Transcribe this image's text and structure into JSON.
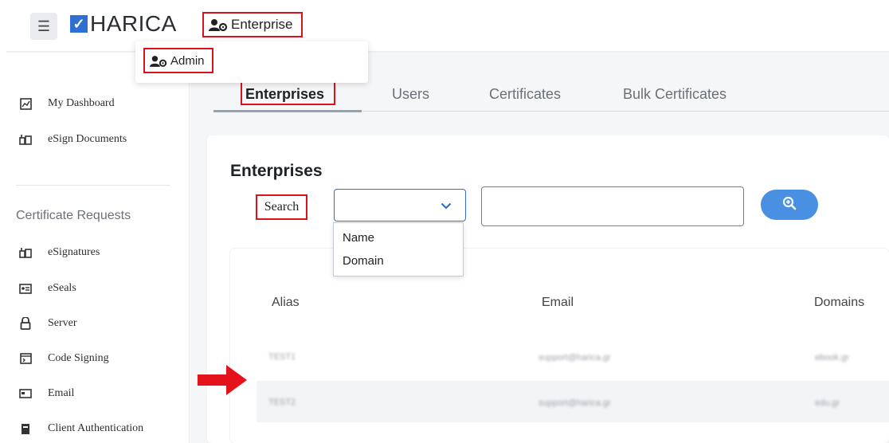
{
  "header": {
    "menu_icon": "hamburger-icon",
    "logo_text": "HARICA",
    "role_button_label": "Enterprise",
    "role_menu": {
      "item_label": "Admin"
    }
  },
  "sidebar": {
    "items_top": [
      {
        "label": "My Dashboard",
        "icon": "dashboard-icon"
      },
      {
        "label": "eSign Documents",
        "icon": "esign-documents-icon"
      }
    ],
    "section_heading": "Certificate Requests",
    "items": [
      {
        "label": "eSignatures",
        "icon": "esignature-icon"
      },
      {
        "label": "eSeals",
        "icon": "eseal-icon"
      },
      {
        "label": "Server",
        "icon": "lock-icon"
      },
      {
        "label": "Code Signing",
        "icon": "code-signing-icon"
      },
      {
        "label": "Email",
        "icon": "email-icon"
      },
      {
        "label": "Client Authentication",
        "icon": "client-auth-icon"
      }
    ]
  },
  "tabs": [
    "Enterprises",
    "Users",
    "Certificates",
    "Bulk Certificates"
  ],
  "active_tab": "Enterprises",
  "card": {
    "title": "Enterprises",
    "search_label": "Search",
    "select": {
      "selected_value": "",
      "options": [
        "Name",
        "Domain"
      ]
    },
    "search_input_value": "",
    "search_button_icon": "zoom-in-icon"
  },
  "table": {
    "columns": [
      "Alias",
      "Email",
      "Domains"
    ],
    "rows": [
      {
        "alias": "TEST1",
        "email": "support@harica.gr",
        "domains": "ebook.gr"
      },
      {
        "alias": "TEST2",
        "email": "support@harica.gr",
        "domains": "edu.gr"
      }
    ]
  },
  "colors": {
    "accent": "#4a90e2",
    "highlight": "#d9121b",
    "logo": "#2f6fd1"
  }
}
